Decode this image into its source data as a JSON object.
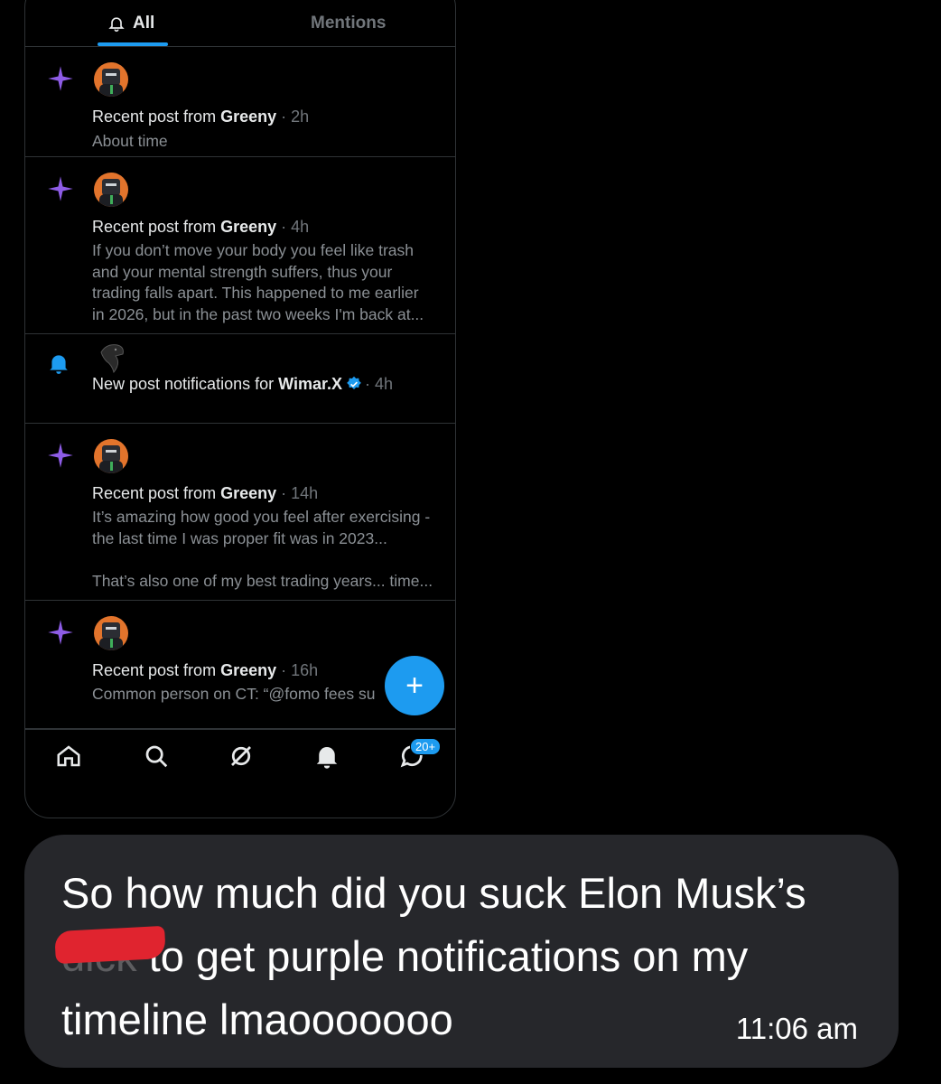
{
  "tabs": {
    "all": "All",
    "mentions": "Mentions"
  },
  "notifications": [
    {
      "type": "recent",
      "prefix": "Recent post from ",
      "user": "Greeny",
      "time": "· 2h",
      "body": [
        "About time"
      ]
    },
    {
      "type": "recent",
      "prefix": "Recent post from ",
      "user": "Greeny",
      "time": "· 4h",
      "body": [
        "If you don’t move your body you feel like trash",
        "and your mental strength suffers, thus your",
        "trading falls apart. This happened to me earlier",
        "in 2026, but in the past two weeks I'm back at..."
      ]
    },
    {
      "type": "bell",
      "prefix": "New post notifications for ",
      "user": "Wimar.X",
      "time": "· 4h",
      "verified": true
    },
    {
      "type": "recent",
      "prefix": "Recent post from ",
      "user": "Greeny",
      "time": "· 14h",
      "body": [
        "It’s amazing how good you feel after exercising -",
        "the last time I was proper fit was in 2023...",
        "",
        "That’s also one of my best trading years... time..."
      ]
    },
    {
      "type": "recent",
      "prefix": "Recent post from ",
      "user": "Greeny",
      "time": "· 16h",
      "body": [
        "Common person on CT: “@fomo fees su"
      ]
    }
  ],
  "fab_label": "+",
  "nav": {
    "icons": [
      "home-icon",
      "search-icon",
      "grok-icon",
      "bell-icon",
      "messages-icon"
    ],
    "badge": "20+"
  },
  "message": {
    "line1": "So how much did you suck Elon Musk’s",
    "line2_start": "dick",
    "line2_rest": "to get purple notifications on my",
    "line3": "timeline lmaooooooo",
    "time": "11:06 am"
  },
  "colors": {
    "accent": "#1d9bf0",
    "sparkle": "#8e5ce6",
    "bubble": "#26272b",
    "redaction": "#e0242f"
  }
}
